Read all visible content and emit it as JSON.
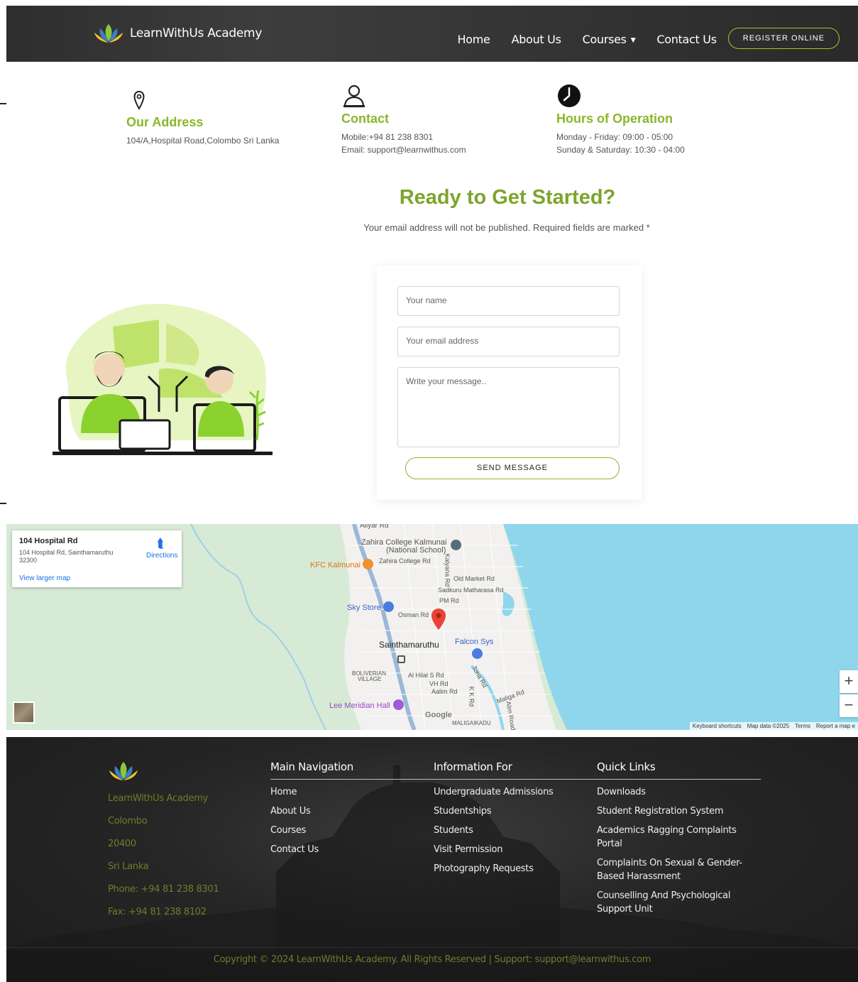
{
  "header": {
    "brand": "LearnWithUs Academy",
    "nav": [
      {
        "label": "Home"
      },
      {
        "label": "About Us"
      },
      {
        "label": "Courses",
        "has_dropdown": true
      },
      {
        "label": "Contact Us"
      }
    ],
    "register_label": "REGISTER ONLINE",
    "accent_color": "#a3c42f"
  },
  "info": {
    "address": {
      "title": "Our Address",
      "line1": "104/A,Hospital Road,Colombo Sri Lanka",
      "icon": "location-pin-icon"
    },
    "contact": {
      "title": "Contact",
      "line1": "Mobile:+94 81 238 8301",
      "line2": "Email: support@learnwithus.com",
      "icon": "person-icon"
    },
    "hours": {
      "title": "Hours of Operation",
      "line1": "Monday - Friday: 09:00 - 05:00",
      "line2": "Sunday & Saturday: 10:30 - 04:00",
      "icon": "clock-icon"
    },
    "title_color": "#8ab72a"
  },
  "cta": {
    "title": "Ready to Get Started?",
    "subtitle": "Your email address will not be published. Required fields are marked *"
  },
  "form": {
    "name_placeholder": "Your name",
    "email_placeholder": "Your email address",
    "message_placeholder": "Write your message..",
    "send_label": "SEND MESSAGE"
  },
  "map": {
    "card": {
      "title": "104 Hospital Rd",
      "address": "104 Hospital Rd, Sainthamaruthu 32300",
      "directions": "Directions",
      "larger_map": "View larger map"
    },
    "labels": {
      "aliyar": "Aliyar Rd",
      "zahira": "Zahira College Kalmunai",
      "national": "(National School)",
      "kfc": "KFC Kalmunai",
      "zahira_rd": "Zahira College Rd",
      "kalyana": "Kalyana Rd",
      "old_market": "Old Market Rd",
      "sadkuru": "Sadkuru Matharasa Rd",
      "pm": "PM Rd",
      "sky": "Sky Store",
      "osman": "Osman Rd",
      "falcon": "Falcon Sys",
      "town": "Sainthamaruthu",
      "boliverian1": "BOLIVERIAN",
      "boliverian2": "VILLAGE",
      "alhilal": "Al Hilal S Rd",
      "vh": "VH Rd",
      "aalim": "Aalim Rd",
      "kk": "K K Rd",
      "tona": "Tona Rd",
      "maliga": "Maliga Rd",
      "alim2": "Alim Road",
      "lee": "Lee Meridian Hall",
      "maligaikadu": "MALIGAIKADU",
      "google": "Google"
    },
    "zoom_in": "+",
    "zoom_out": "−",
    "footer": {
      "shortcuts": "Keyboard shortcuts",
      "data": "Map data ©2025",
      "terms": "Terms",
      "report": "Report a map e"
    }
  },
  "footer": {
    "brand": "LearnWithUs Academy",
    "address_lines": [
      "Colombo",
      "20400",
      "Sri Lanka",
      "Phone: +94 81 238 8301",
      "Fax: +94 81 238 8102"
    ],
    "columns": [
      {
        "title": "Main Navigation",
        "links": [
          "Home",
          "About Us",
          "Courses",
          "Contact Us"
        ]
      },
      {
        "title": "Information For",
        "links": [
          "Undergraduate Admissions",
          "Studentships",
          "Students",
          "Visit Permission",
          "Photography Requests"
        ]
      },
      {
        "title": "Quick Links",
        "links": [
          "Downloads",
          "Student Registration System",
          "Academics Ragging Complaints Portal",
          "Complaints On Sexual & Gender-Based Harassment",
          "Counselling And Psychological Support Unit"
        ]
      }
    ],
    "copyright": "Copyright © 2024 LearnWithUs Academy. All Rights Reserved | Support: support@learnwithus.com",
    "address_color": "#6f7d2a"
  }
}
